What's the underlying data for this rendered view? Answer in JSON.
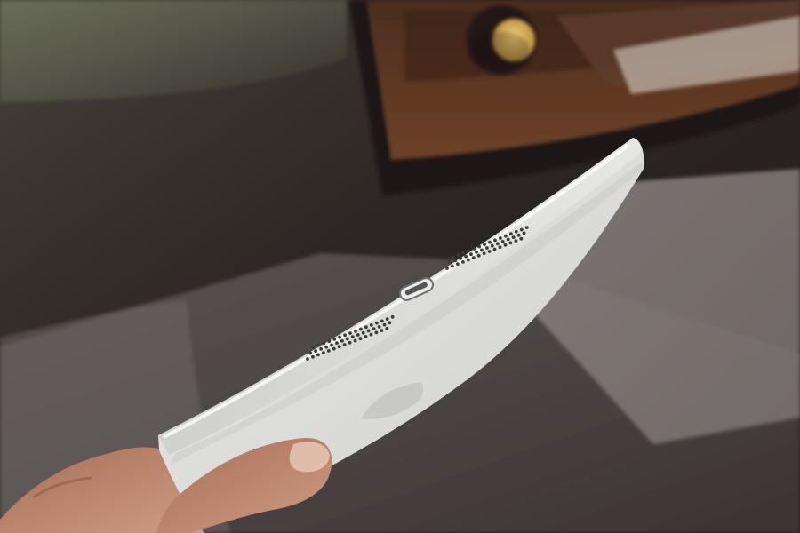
{
  "image": {
    "kind": "photograph",
    "subject": "tablet-bottom-edge",
    "colors": {
      "tablet_body": "#d9d8d6",
      "tablet_edge_highlight": "#f4f4f2",
      "background_floor": "#3a3331",
      "radio_wood": "#5b3620",
      "radio_knob": "#c8a14a",
      "hand_skin": "#b9856b"
    },
    "features": [
      {
        "name": "speaker-grille",
        "count": 2
      },
      {
        "name": "lightning-port",
        "count": 1
      },
      {
        "name": "apple-logo",
        "count": 1
      }
    ]
  }
}
